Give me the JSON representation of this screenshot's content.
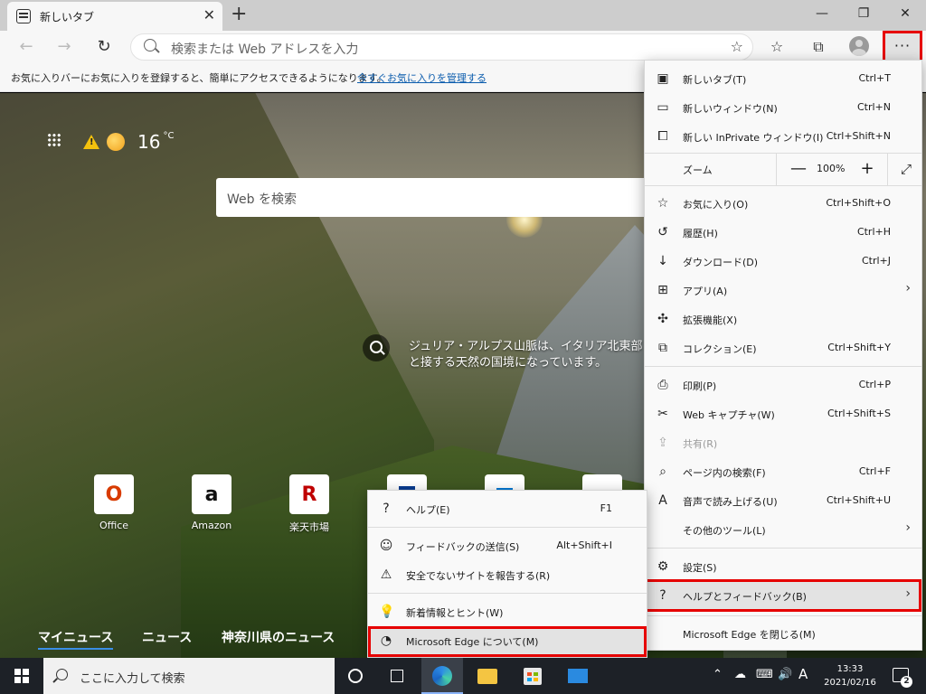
{
  "tab": {
    "title": "新しいタブ"
  },
  "window_controls": {
    "minimize": "—",
    "restore": "❐",
    "close": "✕"
  },
  "address": {
    "placeholder": "検索または Web アドレスを入力"
  },
  "favorites_bar": {
    "text": "お気に入りバーにお気に入りを登録すると、簡単にアクセスできるようになります。",
    "link": "今すぐお気に入りを管理する"
  },
  "newtab": {
    "weather": {
      "temp": "16",
      "unit": "°C"
    },
    "search_placeholder": "Web を検索",
    "caption": "ジュリア・アルプス山脈は、イタリア北東部と接する天然の国境になっています。",
    "tiles": [
      {
        "label": "Office",
        "glyph": "O",
        "color": "#d83b01"
      },
      {
        "label": "Amazon",
        "glyph": "a",
        "color": "#111111"
      },
      {
        "label": "楽天市場",
        "glyph": "R",
        "color": "#bf0000"
      },
      {
        "label": "",
        "glyph": "",
        "color": "#0a3d91"
      },
      {
        "label": "",
        "glyph": "",
        "color": "#0078d4"
      },
      {
        "label": "",
        "glyph": "",
        "color": "#888888"
      }
    ],
    "news_tabs": [
      "マイニュース",
      "ニュース",
      "神奈川県のニュース"
    ]
  },
  "menu": {
    "items": [
      {
        "label": "新しいタブ(T)",
        "shortcut": "Ctrl+T",
        "icon": "tab-icon"
      },
      {
        "label": "新しいウィンドウ(N)",
        "shortcut": "Ctrl+N",
        "icon": "window-icon"
      },
      {
        "label": "新しい InPrivate ウィンドウ(I)",
        "shortcut": "Ctrl+Shift+N",
        "icon": "inprivate-icon"
      }
    ],
    "zoom": {
      "label": "ズーム",
      "value": "100%",
      "minus": "—",
      "plus": "+",
      "full": "⤢"
    },
    "items2": [
      {
        "label": "お気に入り(O)",
        "shortcut": "Ctrl+Shift+O",
        "icon": "favorites-icon"
      },
      {
        "label": "履歴(H)",
        "shortcut": "Ctrl+H",
        "icon": "history-icon"
      },
      {
        "label": "ダウンロード(D)",
        "shortcut": "Ctrl+J",
        "icon": "download-icon"
      },
      {
        "label": "アプリ(A)",
        "shortcut": "",
        "icon": "apps-icon",
        "arrow": true
      },
      {
        "label": "拡張機能(X)",
        "shortcut": "",
        "icon": "extensions-icon"
      },
      {
        "label": "コレクション(E)",
        "shortcut": "Ctrl+Shift+Y",
        "icon": "collections-icon"
      }
    ],
    "items3": [
      {
        "label": "印刷(P)",
        "shortcut": "Ctrl+P",
        "icon": "print-icon"
      },
      {
        "label": "Web キャプチャ(W)",
        "shortcut": "Ctrl+Shift+S",
        "icon": "capture-icon"
      },
      {
        "label": "共有(R)",
        "shortcut": "",
        "icon": "share-icon",
        "disabled": true
      },
      {
        "label": "ページ内の検索(F)",
        "shortcut": "Ctrl+F",
        "icon": "find-icon"
      },
      {
        "label": "音声で読み上げる(U)",
        "shortcut": "Ctrl+Shift+U",
        "icon": "read-aloud-icon"
      },
      {
        "label": "その他のツール(L)",
        "shortcut": "",
        "icon": "",
        "arrow": true
      }
    ],
    "items4": [
      {
        "label": "設定(S)",
        "shortcut": "",
        "icon": "settings-icon"
      },
      {
        "label": "ヘルプとフィードバック(B)",
        "shortcut": "",
        "icon": "help-icon",
        "arrow": true,
        "highlight": true
      },
      {
        "label": "Microsoft Edge を閉じる(M)",
        "shortcut": "",
        "icon": ""
      }
    ]
  },
  "submenu": {
    "items": [
      {
        "label": "ヘルプ(E)",
        "shortcut": "F1",
        "icon": "help-icon"
      },
      {
        "label": "フィードバックの送信(S)",
        "shortcut": "Alt+Shift+I",
        "icon": "feedback-icon"
      },
      {
        "label": "安全でないサイトを報告する(R)",
        "shortcut": "",
        "icon": "warning-icon"
      },
      {
        "label": "新着情報とヒント(W)",
        "shortcut": "",
        "icon": "lightbulb-icon"
      },
      {
        "label": "Microsoft Edge について(M)",
        "shortcut": "",
        "icon": "edge-icon",
        "highlight": true
      }
    ]
  },
  "taskbar": {
    "search_placeholder": "ここに入力して検索",
    "time": "13:33",
    "date": "2021/02/16",
    "ime": "A",
    "notifications": "2"
  },
  "colors": {
    "accent_red": "#e60000",
    "link": "#0b5cad"
  }
}
